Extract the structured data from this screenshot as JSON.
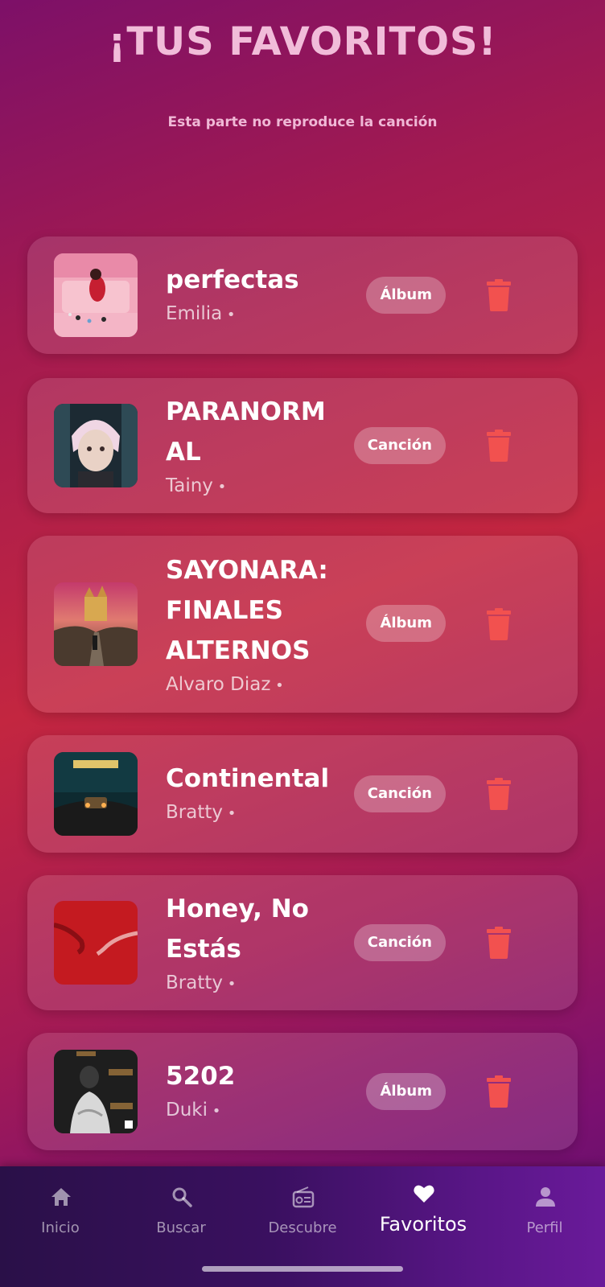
{
  "header": {
    "title": "¡TUS FAVORITOS!",
    "subtitle": "Esta parte no reproduce la canción"
  },
  "favorites": [
    {
      "title": "perfectas",
      "artist": "Emilia",
      "type": "Álbum",
      "cover": "pink-room-cover"
    },
    {
      "title": "PARANORM AL",
      "artist": "Tainy",
      "type": "Canción",
      "cover": "anime-character-cover"
    },
    {
      "title": "SAYONARA: FINALES ALTERNOS",
      "artist": "Alvaro Diaz",
      "type": "Álbum",
      "cover": "sunset-castle-cover"
    },
    {
      "title": "Continental",
      "artist": "Bratty",
      "type": "Canción",
      "cover": "night-car-cover"
    },
    {
      "title": "Honey, No Estás",
      "artist": "Bratty",
      "type": "Canción",
      "cover": "red-hands-cover"
    },
    {
      "title": "5202",
      "artist": "Duki",
      "type": "Álbum",
      "cover": "numbers-portrait-cover"
    }
  ],
  "nav": {
    "items": [
      {
        "label": "Inicio",
        "icon": "home-icon"
      },
      {
        "label": "Buscar",
        "icon": "search-icon"
      },
      {
        "label": "Descubre",
        "icon": "radio-icon"
      },
      {
        "label": "Favoritos",
        "icon": "heart-icon",
        "active": true
      },
      {
        "label": "Perfil",
        "icon": "person-icon"
      }
    ]
  },
  "colors": {
    "delete": "#f2514f",
    "title": "#f1bcd9"
  }
}
